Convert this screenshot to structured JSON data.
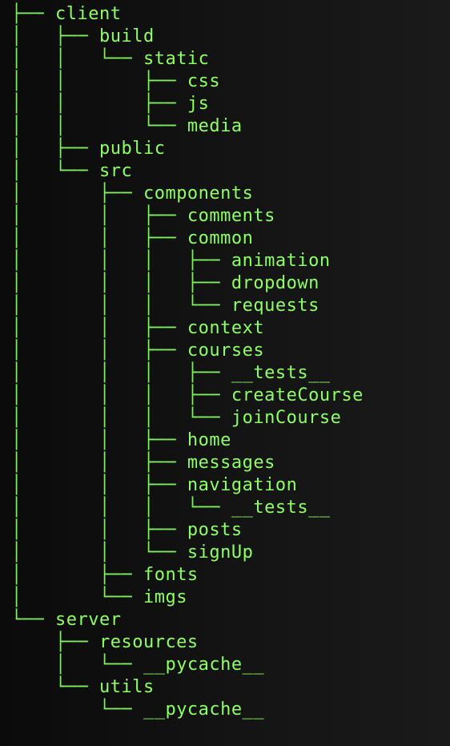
{
  "tree": {
    "lines": [
      {
        "prefix": "├── ",
        "label": "client"
      },
      {
        "prefix": "│   ├── ",
        "label": "build"
      },
      {
        "prefix": "│   │   └── ",
        "label": "static"
      },
      {
        "prefix": "│   │       ├── ",
        "label": "css"
      },
      {
        "prefix": "│   │       ├── ",
        "label": "js"
      },
      {
        "prefix": "│   │       └── ",
        "label": "media"
      },
      {
        "prefix": "│   ├── ",
        "label": "public"
      },
      {
        "prefix": "│   └── ",
        "label": "src"
      },
      {
        "prefix": "│       ├── ",
        "label": "components"
      },
      {
        "prefix": "│       │   ├── ",
        "label": "comments"
      },
      {
        "prefix": "│       │   ├── ",
        "label": "common"
      },
      {
        "prefix": "│       │   │   ├── ",
        "label": "animation"
      },
      {
        "prefix": "│       │   │   ├── ",
        "label": "dropdown"
      },
      {
        "prefix": "│       │   │   └── ",
        "label": "requests"
      },
      {
        "prefix": "│       │   ├── ",
        "label": "context"
      },
      {
        "prefix": "│       │   ├── ",
        "label": "courses"
      },
      {
        "prefix": "│       │   │   ├── ",
        "label": "__tests__"
      },
      {
        "prefix": "│       │   │   ├── ",
        "label": "createCourse"
      },
      {
        "prefix": "│       │   │   └── ",
        "label": "joinCourse"
      },
      {
        "prefix": "│       │   ├── ",
        "label": "home"
      },
      {
        "prefix": "│       │   ├── ",
        "label": "messages"
      },
      {
        "prefix": "│       │   ├── ",
        "label": "navigation"
      },
      {
        "prefix": "│       │   │   └── ",
        "label": "__tests__"
      },
      {
        "prefix": "│       │   ├── ",
        "label": "posts"
      },
      {
        "prefix": "│       │   └── ",
        "label": "signUp"
      },
      {
        "prefix": "│       ├── ",
        "label": "fonts"
      },
      {
        "prefix": "│       └── ",
        "label": "imgs"
      },
      {
        "prefix": "└── ",
        "label": "server"
      },
      {
        "prefix": "    ├── ",
        "label": "resources"
      },
      {
        "prefix": "    │   └── ",
        "label": "__pycache__"
      },
      {
        "prefix": "    └── ",
        "label": "utils"
      },
      {
        "prefix": "        └── ",
        "label": "__pycache__"
      }
    ]
  },
  "colors": {
    "text": "#8cff63",
    "background": "#121212"
  }
}
